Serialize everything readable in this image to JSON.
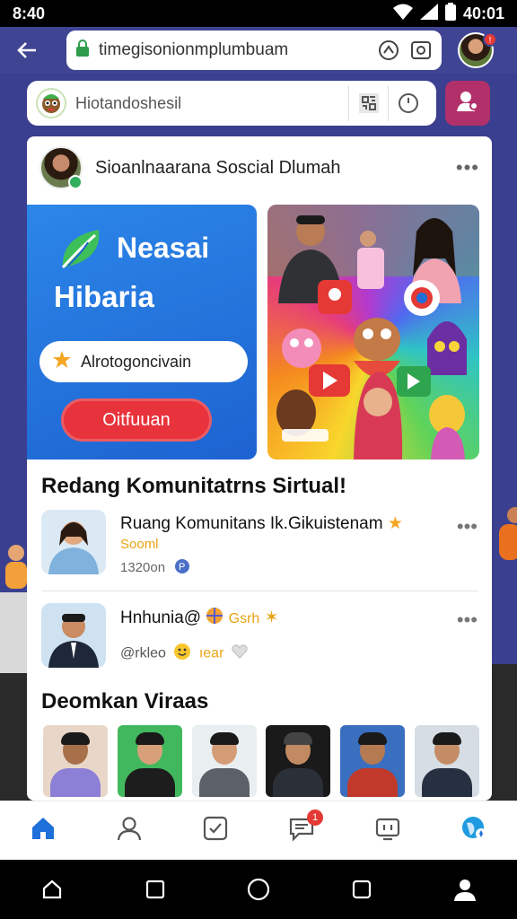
{
  "status_bar": {
    "time": "8:40",
    "clock_right": "40:01"
  },
  "browser": {
    "url": "timegisonionmplumbuam",
    "notification_count": "!"
  },
  "search": {
    "placeholder": "Hiotandoshesil"
  },
  "card": {
    "header_title": "Sioanlnaarana Soscial Dlumah",
    "promo": {
      "brand_line1": "Neasai",
      "brand_line2": "Hibaria",
      "pill_text": "Alrotogoncivain",
      "cta_label": "Oitfuuan"
    },
    "section1_title": "Redang Komunitatrns Sirtual!",
    "posts": [
      {
        "title": "Ruang Komunitans Ik.Gikuistenam",
        "star": "★",
        "sub1": "Sooml",
        "sub2": "1320on"
      },
      {
        "title": "Hnhunia@",
        "title_extra": "Gsrh",
        "sub1": "@rkleo",
        "sub2": "ıear"
      }
    ],
    "section2_title": "Deomkan Viraas"
  },
  "bottom_nav": {
    "messages_badge": "1"
  },
  "colors": {
    "brand_blue": "#1d63d1",
    "accent_red": "#e8323c",
    "header_bg": "#3f4493",
    "active_nav": "#1e6fd9"
  }
}
